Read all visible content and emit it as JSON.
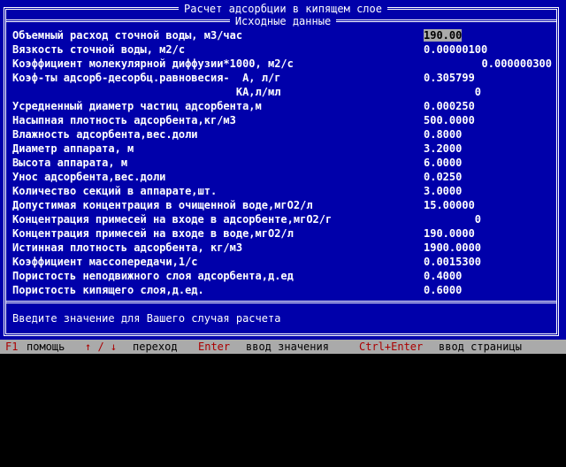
{
  "window": {
    "title": "Расчет адсорбции в кипящем слое",
    "section": "Исходные данные"
  },
  "fields": [
    {
      "label": "Объемный расход сточной воды, м3/час",
      "value": "190.00"
    },
    {
      "label": "Вязкость сточной воды, м2/с",
      "value": "0.00000100"
    },
    {
      "label": "Коэффициент молекулярной диффузии*1000, м2/с",
      "value": "0.000000300"
    },
    {
      "label": "Коэф-ты адсорб-десорбц.равновесия-  A, л/г",
      "value": "0.305799"
    },
    {
      "label": "                                   KA,л/мл",
      "value": "0"
    },
    {
      "label": "Усредненный диаметр частиц адсорбента,м",
      "value": "0.000250"
    },
    {
      "label": "Насыпная плотность адсорбента,кг/м3",
      "value": "500.0000"
    },
    {
      "label": "Влажность адсорбента,вес.доли",
      "value": "0.8000"
    },
    {
      "label": "Диаметр аппарата, м",
      "value": "3.2000"
    },
    {
      "label": "Высота аппарата, м",
      "value": "6.0000"
    },
    {
      "label": "Унос адсорбента,вес.доли",
      "value": "0.0250"
    },
    {
      "label": "Количество секций в аппарате,шт.",
      "value": "3.0000"
    },
    {
      "label": "Допустимая концентрация в очищенной воде,мгО2/л",
      "value": "15.00000"
    },
    {
      "label": "Концентрация примесей на входе в адсорбенте,мгО2/г",
      "value": "0"
    },
    {
      "label": "Концентрация примесей на входе в воде,мгО2/л",
      "value": "190.0000"
    },
    {
      "label": "Истинная плотность адсорбента, кг/м3",
      "value": "1900.0000"
    },
    {
      "label": "Коэффициент массопередачи,1/с",
      "value": "0.0015300"
    },
    {
      "label": "Пористость неподвижного слоя адсорбента,д.ед",
      "value": "0.4000"
    },
    {
      "label": "Пористость кипящего слоя,д.ед.",
      "value": "0.6000"
    }
  ],
  "message": "Введите значение для Вашего случая расчета",
  "statusbar": {
    "f1_key": "F1",
    "f1_label": "помощь",
    "arrows_key": "↑ / ↓",
    "arrows_label": "переход",
    "enter_key": "Enter",
    "enter_label": "ввод значения",
    "ctrl_enter_key": "Ctrl+Enter",
    "ctrl_enter_label": "ввод страницы"
  }
}
